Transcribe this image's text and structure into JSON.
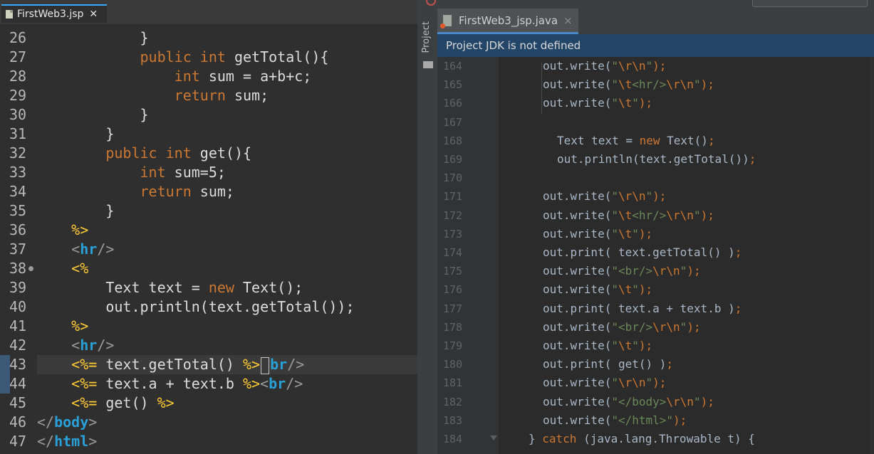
{
  "left_editor": {
    "tab_label": "FirstWeb3.jsp",
    "close_glyph": "✕",
    "lines": [
      {
        "n": "26",
        "segs": [
          {
            "t": "            ",
            "c": "txt"
          },
          {
            "t": "}",
            "c": "txt"
          }
        ]
      },
      {
        "n": "27",
        "segs": [
          {
            "t": "            ",
            "c": "txt"
          },
          {
            "t": "public",
            "c": "kw"
          },
          {
            "t": " ",
            "c": "txt"
          },
          {
            "t": "int",
            "c": "kw"
          },
          {
            "t": " getTotal(){",
            "c": "txt"
          }
        ]
      },
      {
        "n": "28",
        "segs": [
          {
            "t": "                ",
            "c": "txt"
          },
          {
            "t": "int",
            "c": "kw"
          },
          {
            "t": " sum = a+b+c;",
            "c": "txt"
          }
        ]
      },
      {
        "n": "29",
        "segs": [
          {
            "t": "                ",
            "c": "txt"
          },
          {
            "t": "return",
            "c": "kw"
          },
          {
            "t": " sum;",
            "c": "txt"
          }
        ]
      },
      {
        "n": "30",
        "segs": [
          {
            "t": "            ",
            "c": "txt"
          },
          {
            "t": "}",
            "c": "txt"
          }
        ]
      },
      {
        "n": "31",
        "segs": [
          {
            "t": "        ",
            "c": "txt"
          },
          {
            "t": "}",
            "c": "txt"
          }
        ]
      },
      {
        "n": "32",
        "segs": [
          {
            "t": "        ",
            "c": "txt"
          },
          {
            "t": "public",
            "c": "kw"
          },
          {
            "t": " ",
            "c": "txt"
          },
          {
            "t": "int",
            "c": "kw"
          },
          {
            "t": " get(){",
            "c": "txt"
          }
        ]
      },
      {
        "n": "33",
        "segs": [
          {
            "t": "            ",
            "c": "txt"
          },
          {
            "t": "int",
            "c": "kw"
          },
          {
            "t": " sum=5;",
            "c": "txt"
          }
        ]
      },
      {
        "n": "34",
        "segs": [
          {
            "t": "            ",
            "c": "txt"
          },
          {
            "t": "return",
            "c": "kw"
          },
          {
            "t": " sum;",
            "c": "txt"
          }
        ]
      },
      {
        "n": "35",
        "segs": [
          {
            "t": "        ",
            "c": "txt"
          },
          {
            "t": "}",
            "c": "txt"
          }
        ]
      },
      {
        "n": "36",
        "segs": [
          {
            "t": "    ",
            "c": "txt"
          },
          {
            "t": "%>",
            "c": "sc"
          }
        ]
      },
      {
        "n": "37",
        "segs": [
          {
            "t": "    ",
            "c": "txt"
          },
          {
            "t": "<",
            "c": "br"
          },
          {
            "t": "hr",
            "c": "tag"
          },
          {
            "t": "/>",
            "c": "br"
          }
        ]
      },
      {
        "n": "38",
        "fold": true,
        "segs": [
          {
            "t": "    ",
            "c": "txt"
          },
          {
            "t": "<%",
            "c": "sc"
          }
        ]
      },
      {
        "n": "39",
        "segs": [
          {
            "t": "        Text text = ",
            "c": "txt"
          },
          {
            "t": "new",
            "c": "kw"
          },
          {
            "t": " Text();",
            "c": "txt"
          }
        ]
      },
      {
        "n": "40",
        "segs": [
          {
            "t": "        out.println(text.getTotal());",
            "c": "txt"
          }
        ]
      },
      {
        "n": "41",
        "segs": [
          {
            "t": "    ",
            "c": "txt"
          },
          {
            "t": "%>",
            "c": "sc"
          }
        ]
      },
      {
        "n": "42",
        "segs": [
          {
            "t": "    ",
            "c": "txt"
          },
          {
            "t": "<",
            "c": "br"
          },
          {
            "t": "hr",
            "c": "tag"
          },
          {
            "t": "/>",
            "c": "br"
          }
        ]
      },
      {
        "n": "43",
        "current": true,
        "marker": true,
        "segs": [
          {
            "t": "    ",
            "c": "txt"
          },
          {
            "t": "<%=",
            "c": "sc"
          },
          {
            "t": " text.getTotal() ",
            "c": "txt"
          },
          {
            "t": "%>",
            "c": "sc"
          },
          {
            "t": "",
            "c": "cursor"
          },
          {
            "t": "br",
            "c": "tag"
          },
          {
            "t": "/>",
            "c": "br"
          }
        ]
      },
      {
        "n": "44",
        "marker": true,
        "segs": [
          {
            "t": "    ",
            "c": "txt"
          },
          {
            "t": "<%=",
            "c": "sc"
          },
          {
            "t": " text.a + text.b ",
            "c": "txt"
          },
          {
            "t": "%>",
            "c": "sc"
          },
          {
            "t": "<",
            "c": "br"
          },
          {
            "t": "br",
            "c": "tag"
          },
          {
            "t": "/>",
            "c": "br"
          }
        ]
      },
      {
        "n": "45",
        "segs": [
          {
            "t": "    ",
            "c": "txt"
          },
          {
            "t": "<%=",
            "c": "sc"
          },
          {
            "t": " get() ",
            "c": "txt"
          },
          {
            "t": "%>",
            "c": "sc"
          }
        ]
      },
      {
        "n": "46",
        "segs": [
          {
            "t": "</",
            "c": "br"
          },
          {
            "t": "body",
            "c": "tag"
          },
          {
            "t": ">",
            "c": "br"
          }
        ]
      },
      {
        "n": "47",
        "segs": [
          {
            "t": "</",
            "c": "br"
          },
          {
            "t": "html",
            "c": "tag"
          },
          {
            "t": ">",
            "c": "br"
          }
        ]
      }
    ]
  },
  "right_editor": {
    "project_label": "Project",
    "tab_label": "FirstWeb3_jsp.java",
    "close_glyph": "×",
    "banner": "Project JDK is not defined",
    "lines": [
      {
        "n": "164",
        "i": 0,
        "segs": [
          {
            "t": "out.write(",
            "c": ""
          },
          {
            "t": "\"",
            "c": "rstr"
          },
          {
            "t": "\\r\\n",
            "c": "resc"
          },
          {
            "t": "\"",
            "c": "rstr"
          },
          {
            "t": ");",
            "c": "rp"
          }
        ]
      },
      {
        "n": "165",
        "i": 0,
        "segs": [
          {
            "t": "out.write(",
            "c": ""
          },
          {
            "t": "\"",
            "c": "rstr"
          },
          {
            "t": "\\t",
            "c": "resc"
          },
          {
            "t": "<hr/>",
            "c": "rstr"
          },
          {
            "t": "\\r\\n",
            "c": "resc"
          },
          {
            "t": "\"",
            "c": "rstr"
          },
          {
            "t": ");",
            "c": "rp"
          }
        ]
      },
      {
        "n": "166",
        "i": 0,
        "segs": [
          {
            "t": "out.write(",
            "c": ""
          },
          {
            "t": "\"",
            "c": "rstr"
          },
          {
            "t": "\\t",
            "c": "resc"
          },
          {
            "t": "\"",
            "c": "rstr"
          },
          {
            "t": ");",
            "c": "rp"
          }
        ]
      },
      {
        "n": "167",
        "i": 0,
        "segs": []
      },
      {
        "n": "168",
        "i": 1,
        "segs": [
          {
            "t": "Text text = ",
            "c": ""
          },
          {
            "t": "new",
            "c": "rkw"
          },
          {
            "t": " Text()",
            "c": ""
          },
          {
            "t": ";",
            "c": "rp"
          }
        ]
      },
      {
        "n": "169",
        "i": 1,
        "segs": [
          {
            "t": "out.println(text.getTotal())",
            "c": ""
          },
          {
            "t": ";",
            "c": "rp"
          }
        ]
      },
      {
        "n": "170",
        "i": 0,
        "segs": []
      },
      {
        "n": "171",
        "i": 0,
        "segs": [
          {
            "t": "out.write(",
            "c": ""
          },
          {
            "t": "\"",
            "c": "rstr"
          },
          {
            "t": "\\r\\n",
            "c": "resc"
          },
          {
            "t": "\"",
            "c": "rstr"
          },
          {
            "t": ");",
            "c": "rp"
          }
        ]
      },
      {
        "n": "172",
        "i": 0,
        "segs": [
          {
            "t": "out.write(",
            "c": ""
          },
          {
            "t": "\"",
            "c": "rstr"
          },
          {
            "t": "\\t",
            "c": "resc"
          },
          {
            "t": "<hr/>",
            "c": "rstr"
          },
          {
            "t": "\\r\\n",
            "c": "resc"
          },
          {
            "t": "\"",
            "c": "rstr"
          },
          {
            "t": ");",
            "c": "rp"
          }
        ]
      },
      {
        "n": "173",
        "i": 0,
        "segs": [
          {
            "t": "out.write(",
            "c": ""
          },
          {
            "t": "\"",
            "c": "rstr"
          },
          {
            "t": "\\t",
            "c": "resc"
          },
          {
            "t": "\"",
            "c": "rstr"
          },
          {
            "t": ");",
            "c": "rp"
          }
        ]
      },
      {
        "n": "174",
        "i": 0,
        "segs": [
          {
            "t": "out.print( text.getTotal() )",
            "c": ""
          },
          {
            "t": ";",
            "c": "rp"
          }
        ]
      },
      {
        "n": "175",
        "i": 0,
        "segs": [
          {
            "t": "out.write(",
            "c": ""
          },
          {
            "t": "\"",
            "c": "rstr"
          },
          {
            "t": "<br/>",
            "c": "rstr"
          },
          {
            "t": "\\r\\n",
            "c": "resc"
          },
          {
            "t": "\"",
            "c": "rstr"
          },
          {
            "t": ");",
            "c": "rp"
          }
        ]
      },
      {
        "n": "176",
        "i": 0,
        "segs": [
          {
            "t": "out.write(",
            "c": ""
          },
          {
            "t": "\"",
            "c": "rstr"
          },
          {
            "t": "\\t",
            "c": "resc"
          },
          {
            "t": "\"",
            "c": "rstr"
          },
          {
            "t": ");",
            "c": "rp"
          }
        ]
      },
      {
        "n": "177",
        "i": 0,
        "segs": [
          {
            "t": "out.print( text.a + text.b )",
            "c": ""
          },
          {
            "t": ";",
            "c": "rp"
          }
        ]
      },
      {
        "n": "178",
        "i": 0,
        "segs": [
          {
            "t": "out.write(",
            "c": ""
          },
          {
            "t": "\"",
            "c": "rstr"
          },
          {
            "t": "<br/>",
            "c": "rstr"
          },
          {
            "t": "\\r\\n",
            "c": "resc"
          },
          {
            "t": "\"",
            "c": "rstr"
          },
          {
            "t": ");",
            "c": "rp"
          }
        ]
      },
      {
        "n": "179",
        "i": 0,
        "segs": [
          {
            "t": "out.write(",
            "c": ""
          },
          {
            "t": "\"",
            "c": "rstr"
          },
          {
            "t": "\\t",
            "c": "resc"
          },
          {
            "t": "\"",
            "c": "rstr"
          },
          {
            "t": ");",
            "c": "rp"
          }
        ]
      },
      {
        "n": "180",
        "i": 0,
        "segs": [
          {
            "t": "out.print( get() )",
            "c": ""
          },
          {
            "t": ";",
            "c": "rp"
          }
        ]
      },
      {
        "n": "181",
        "i": 0,
        "segs": [
          {
            "t": "out.write(",
            "c": ""
          },
          {
            "t": "\"",
            "c": "rstr"
          },
          {
            "t": "\\r\\n",
            "c": "resc"
          },
          {
            "t": "\"",
            "c": "rstr"
          },
          {
            "t": ");",
            "c": "rp"
          }
        ]
      },
      {
        "n": "182",
        "i": 0,
        "segs": [
          {
            "t": "out.write(",
            "c": ""
          },
          {
            "t": "\"",
            "c": "rstr"
          },
          {
            "t": "</body>",
            "c": "rstr"
          },
          {
            "t": "\\r\\n",
            "c": "resc"
          },
          {
            "t": "\"",
            "c": "rstr"
          },
          {
            "t": ");",
            "c": "rp"
          }
        ]
      },
      {
        "n": "183",
        "i": 0,
        "segs": [
          {
            "t": "out.write(",
            "c": ""
          },
          {
            "t": "\"",
            "c": "rstr"
          },
          {
            "t": "</html>",
            "c": "rstr"
          },
          {
            "t": "\"",
            "c": "rstr"
          },
          {
            "t": ");",
            "c": "rp"
          }
        ]
      },
      {
        "n": "184",
        "i": -1,
        "fold": true,
        "segs": [
          {
            "t": "} ",
            "c": ""
          },
          {
            "t": "catch",
            "c": "rkw"
          },
          {
            "t": " (java.lang.Throwable t) {",
            "c": ""
          }
        ]
      }
    ]
  },
  "colors": {
    "keyword": "#cc7832",
    "tag": "#2aa0d8",
    "scriptlet": "#ffcc33",
    "string": "#6a8759",
    "banner_bg": "#234567",
    "tab_accent": "#4a88c7"
  }
}
